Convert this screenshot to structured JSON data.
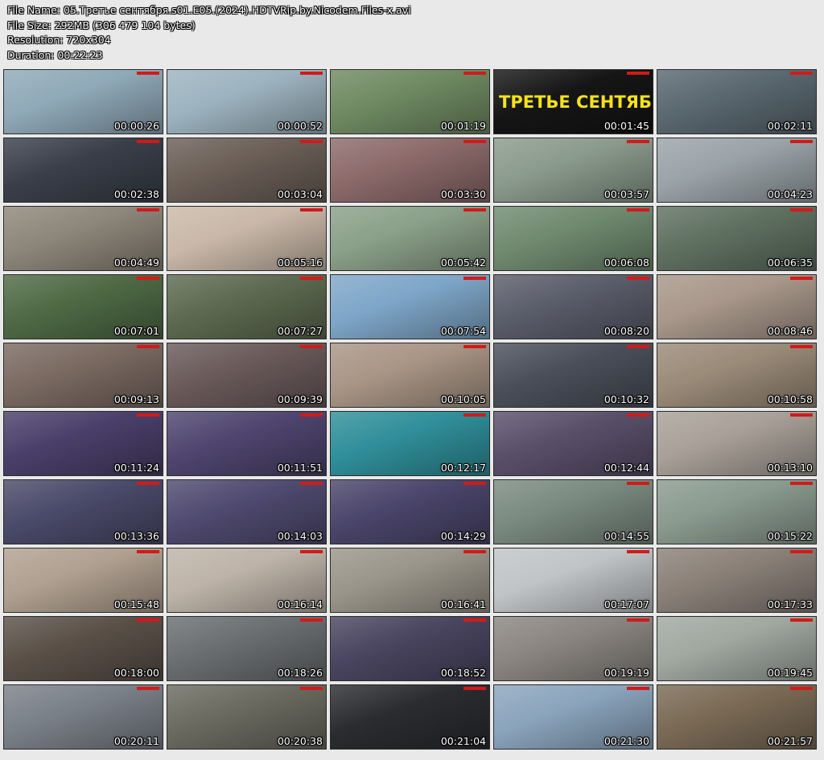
{
  "header": {
    "file_name": "File Name: 05.Третье сентября.s01.E05.(2024).HDTVRip.by.Nicodem.Files-x.avi",
    "file_size": "File Size: 292MB (306 479 104 bytes)",
    "resolution": "Resolution: 720x304",
    "duration": "Duration: 00:22:23"
  },
  "colors": {
    "page_background": "#e9e9e9",
    "timestamp_text": "#ffffff",
    "channel_badge": "#d11a1a",
    "title_card_text": "#f5e21c"
  },
  "thumbnails": [
    {
      "time": "00:00:26",
      "scene": "#8fa9b8"
    },
    {
      "time": "00:00:52",
      "scene": "#9cb3bf"
    },
    {
      "time": "00:01:19",
      "scene": "#6f8a62"
    },
    {
      "time": "00:01:45",
      "scene": "#151515",
      "title_card": "ТРЕТЬЕ СЕНТЯБРЯ"
    },
    {
      "time": "00:02:11",
      "scene": "#5a6870"
    },
    {
      "time": "00:02:38",
      "scene": "#3a3f4a"
    },
    {
      "time": "00:03:04",
      "scene": "#6b5f57"
    },
    {
      "time": "00:03:30",
      "scene": "#8c6a6a"
    },
    {
      "time": "00:03:57",
      "scene": "#8a9a8c"
    },
    {
      "time": "00:04:23",
      "scene": "#9aa3a8"
    },
    {
      "time": "00:04:49",
      "scene": "#8d867a"
    },
    {
      "time": "00:05:16",
      "scene": "#c9b8a8"
    },
    {
      "time": "00:05:42",
      "scene": "#8aa088"
    },
    {
      "time": "00:06:08",
      "scene": "#6f8a6f"
    },
    {
      "time": "00:06:35",
      "scene": "#5f7060"
    },
    {
      "time": "00:07:01",
      "scene": "#4f6a45"
    },
    {
      "time": "00:07:27",
      "scene": "#5d6a50"
    },
    {
      "time": "00:07:54",
      "scene": "#7ea6c8"
    },
    {
      "time": "00:08:20",
      "scene": "#5a5d6a"
    },
    {
      "time": "00:08:46",
      "scene": "#a8978a"
    },
    {
      "time": "00:09:13",
      "scene": "#7a6a62"
    },
    {
      "time": "00:09:39",
      "scene": "#6a5a5a"
    },
    {
      "time": "00:10:05",
      "scene": "#a89585"
    },
    {
      "time": "00:10:32",
      "scene": "#4a4f5a"
    },
    {
      "time": "00:10:58",
      "scene": "#9a8a78"
    },
    {
      "time": "00:11:24",
      "scene": "#4a3f6a"
    },
    {
      "time": "00:11:51",
      "scene": "#4f456f"
    },
    {
      "time": "00:12:17",
      "scene": "#2f8f9a"
    },
    {
      "time": "00:12:44",
      "scene": "#5a4f6a"
    },
    {
      "time": "00:13:10",
      "scene": "#a8a098"
    },
    {
      "time": "00:13:36",
      "scene": "#4a4a6a"
    },
    {
      "time": "00:14:03",
      "scene": "#4f4a6f"
    },
    {
      "time": "00:14:29",
      "scene": "#4a456a"
    },
    {
      "time": "00:14:55",
      "scene": "#7a8a80"
    },
    {
      "time": "00:15:22",
      "scene": "#8a9a8f"
    },
    {
      "time": "00:15:48",
      "scene": "#b0a090"
    },
    {
      "time": "00:16:14",
      "scene": "#bdb3a8"
    },
    {
      "time": "00:16:41",
      "scene": "#9a958a"
    },
    {
      "time": "00:17:07",
      "scene": "#c0c4c6"
    },
    {
      "time": "00:17:33",
      "scene": "#8a8078"
    },
    {
      "time": "00:18:00",
      "scene": "#5a5048"
    },
    {
      "time": "00:18:26",
      "scene": "#6a6e70"
    },
    {
      "time": "00:18:52",
      "scene": "#4a4560"
    },
    {
      "time": "00:19:19",
      "scene": "#8a8580"
    },
    {
      "time": "00:19:45",
      "scene": "#a0a8a0"
    },
    {
      "time": "00:20:11",
      "scene": "#7a8088"
    },
    {
      "time": "00:20:38",
      "scene": "#6a6a60"
    },
    {
      "time": "00:21:04",
      "scene": "#2a2c30"
    },
    {
      "time": "00:21:30",
      "scene": "#8aa4bc"
    },
    {
      "time": "00:21:57",
      "scene": "#7a6a55"
    }
  ]
}
